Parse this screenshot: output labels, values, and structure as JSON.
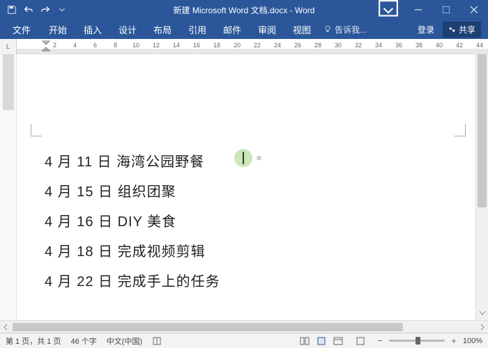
{
  "title": "新建 Microsoft Word 文档.docx - Word",
  "tabs": {
    "file": "文件",
    "home": "开始",
    "insert": "插入",
    "design": "设计",
    "layout": "布局",
    "ref": "引用",
    "mail": "邮件",
    "review": "审阅",
    "view": "视图"
  },
  "tellme": "告诉我...",
  "signin": "登录",
  "share": "共享",
  "ruler_corner": "L",
  "ruler_nums": [
    "2",
    "4",
    "6",
    "8",
    "10",
    "12",
    "14",
    "16",
    "18",
    "20",
    "22",
    "24",
    "26",
    "28",
    "30",
    "32",
    "34",
    "36",
    "38",
    "40",
    "42",
    "44"
  ],
  "lines": [
    "4 月 11 日  海湾公园野餐",
    "4 月 15 日  组织团聚",
    "4 月 16 日  DIY 美食",
    "4 月 18 日  完成视频剪辑",
    "4 月 22 日  完成手上的任务"
  ],
  "status": {
    "page": "第 1 页，共 1 页",
    "words": "46 个字",
    "lang": "中文(中国)",
    "zoom": "100%"
  }
}
